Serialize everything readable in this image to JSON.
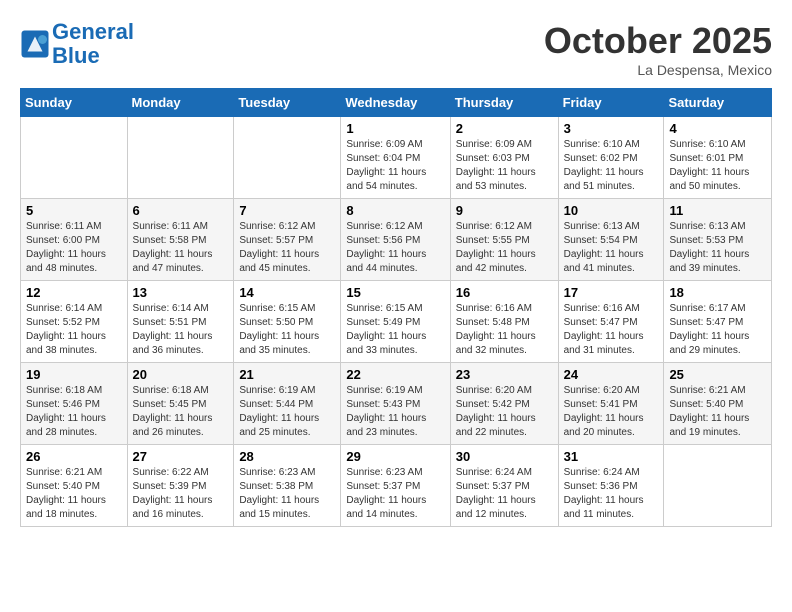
{
  "header": {
    "logo_text_general": "General",
    "logo_text_blue": "Blue",
    "month_title": "October 2025",
    "location": "La Despensa, Mexico"
  },
  "days_of_week": [
    "Sunday",
    "Monday",
    "Tuesday",
    "Wednesday",
    "Thursday",
    "Friday",
    "Saturday"
  ],
  "weeks": [
    [
      {
        "day": "",
        "info": ""
      },
      {
        "day": "",
        "info": ""
      },
      {
        "day": "",
        "info": ""
      },
      {
        "day": "1",
        "info": "Sunrise: 6:09 AM\nSunset: 6:04 PM\nDaylight: 11 hours and 54 minutes."
      },
      {
        "day": "2",
        "info": "Sunrise: 6:09 AM\nSunset: 6:03 PM\nDaylight: 11 hours and 53 minutes."
      },
      {
        "day": "3",
        "info": "Sunrise: 6:10 AM\nSunset: 6:02 PM\nDaylight: 11 hours and 51 minutes."
      },
      {
        "day": "4",
        "info": "Sunrise: 6:10 AM\nSunset: 6:01 PM\nDaylight: 11 hours and 50 minutes."
      }
    ],
    [
      {
        "day": "5",
        "info": "Sunrise: 6:11 AM\nSunset: 6:00 PM\nDaylight: 11 hours and 48 minutes."
      },
      {
        "day": "6",
        "info": "Sunrise: 6:11 AM\nSunset: 5:58 PM\nDaylight: 11 hours and 47 minutes."
      },
      {
        "day": "7",
        "info": "Sunrise: 6:12 AM\nSunset: 5:57 PM\nDaylight: 11 hours and 45 minutes."
      },
      {
        "day": "8",
        "info": "Sunrise: 6:12 AM\nSunset: 5:56 PM\nDaylight: 11 hours and 44 minutes."
      },
      {
        "day": "9",
        "info": "Sunrise: 6:12 AM\nSunset: 5:55 PM\nDaylight: 11 hours and 42 minutes."
      },
      {
        "day": "10",
        "info": "Sunrise: 6:13 AM\nSunset: 5:54 PM\nDaylight: 11 hours and 41 minutes."
      },
      {
        "day": "11",
        "info": "Sunrise: 6:13 AM\nSunset: 5:53 PM\nDaylight: 11 hours and 39 minutes."
      }
    ],
    [
      {
        "day": "12",
        "info": "Sunrise: 6:14 AM\nSunset: 5:52 PM\nDaylight: 11 hours and 38 minutes."
      },
      {
        "day": "13",
        "info": "Sunrise: 6:14 AM\nSunset: 5:51 PM\nDaylight: 11 hours and 36 minutes."
      },
      {
        "day": "14",
        "info": "Sunrise: 6:15 AM\nSunset: 5:50 PM\nDaylight: 11 hours and 35 minutes."
      },
      {
        "day": "15",
        "info": "Sunrise: 6:15 AM\nSunset: 5:49 PM\nDaylight: 11 hours and 33 minutes."
      },
      {
        "day": "16",
        "info": "Sunrise: 6:16 AM\nSunset: 5:48 PM\nDaylight: 11 hours and 32 minutes."
      },
      {
        "day": "17",
        "info": "Sunrise: 6:16 AM\nSunset: 5:47 PM\nDaylight: 11 hours and 31 minutes."
      },
      {
        "day": "18",
        "info": "Sunrise: 6:17 AM\nSunset: 5:47 PM\nDaylight: 11 hours and 29 minutes."
      }
    ],
    [
      {
        "day": "19",
        "info": "Sunrise: 6:18 AM\nSunset: 5:46 PM\nDaylight: 11 hours and 28 minutes."
      },
      {
        "day": "20",
        "info": "Sunrise: 6:18 AM\nSunset: 5:45 PM\nDaylight: 11 hours and 26 minutes."
      },
      {
        "day": "21",
        "info": "Sunrise: 6:19 AM\nSunset: 5:44 PM\nDaylight: 11 hours and 25 minutes."
      },
      {
        "day": "22",
        "info": "Sunrise: 6:19 AM\nSunset: 5:43 PM\nDaylight: 11 hours and 23 minutes."
      },
      {
        "day": "23",
        "info": "Sunrise: 6:20 AM\nSunset: 5:42 PM\nDaylight: 11 hours and 22 minutes."
      },
      {
        "day": "24",
        "info": "Sunrise: 6:20 AM\nSunset: 5:41 PM\nDaylight: 11 hours and 20 minutes."
      },
      {
        "day": "25",
        "info": "Sunrise: 6:21 AM\nSunset: 5:40 PM\nDaylight: 11 hours and 19 minutes."
      }
    ],
    [
      {
        "day": "26",
        "info": "Sunrise: 6:21 AM\nSunset: 5:40 PM\nDaylight: 11 hours and 18 minutes."
      },
      {
        "day": "27",
        "info": "Sunrise: 6:22 AM\nSunset: 5:39 PM\nDaylight: 11 hours and 16 minutes."
      },
      {
        "day": "28",
        "info": "Sunrise: 6:23 AM\nSunset: 5:38 PM\nDaylight: 11 hours and 15 minutes."
      },
      {
        "day": "29",
        "info": "Sunrise: 6:23 AM\nSunset: 5:37 PM\nDaylight: 11 hours and 14 minutes."
      },
      {
        "day": "30",
        "info": "Sunrise: 6:24 AM\nSunset: 5:37 PM\nDaylight: 11 hours and 12 minutes."
      },
      {
        "day": "31",
        "info": "Sunrise: 6:24 AM\nSunset: 5:36 PM\nDaylight: 11 hours and 11 minutes."
      },
      {
        "day": "",
        "info": ""
      }
    ]
  ]
}
